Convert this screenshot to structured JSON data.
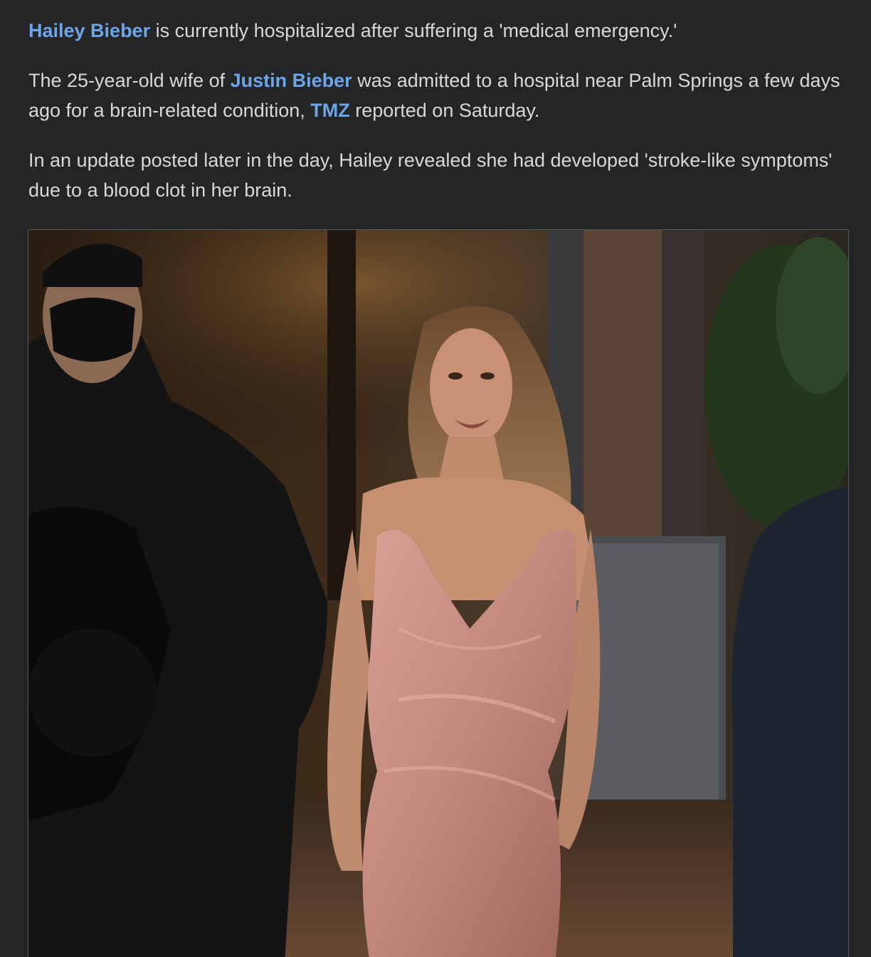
{
  "article": {
    "p1": {
      "link": "Hailey Bieber",
      "text": " is currently hospitalized after suffering a 'medical emergency.'"
    },
    "p2": {
      "t1": "The 25-year-old wife of ",
      "link1": "Justin Bieber",
      "t2": " was admitted to a hospital near Palm Springs a few days ago for a brain-related condition, ",
      "link2": "TMZ",
      "t3": " reported on Saturday."
    },
    "p3": {
      "text": "In an update posted later in the day, Hailey revealed she had developed 'stroke-like symptoms' due to a blood clot in her brain."
    }
  },
  "photo": {
    "subject": "woman-in-pink-satin-dress-walking-at-night",
    "colors": {
      "background": "#242526",
      "link": "#6ea5ea",
      "dress": "#c98a80",
      "hair": "#8a6544"
    }
  }
}
